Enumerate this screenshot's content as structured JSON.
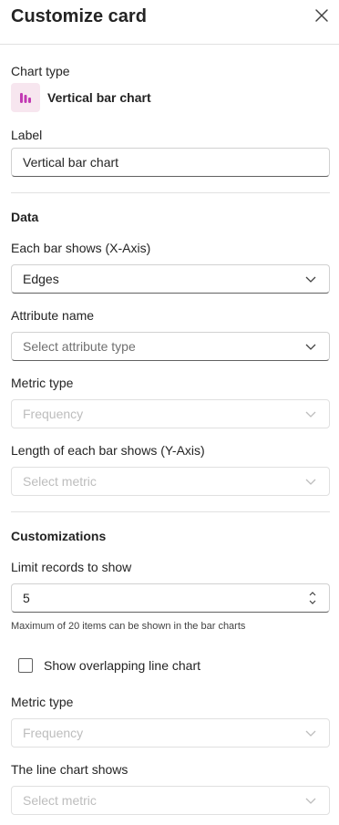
{
  "panel": {
    "title": "Customize card"
  },
  "chart_type": {
    "label": "Chart type",
    "value": "Vertical bar chart",
    "icon": "vertical-bar-chart-icon",
    "accent": "#c239b3"
  },
  "label_field": {
    "label": "Label",
    "value": "Vertical bar chart"
  },
  "data_section": {
    "title": "Data",
    "x_axis": {
      "label": "Each bar shows (X-Axis)",
      "value": "Edges"
    },
    "attribute": {
      "label": "Attribute name",
      "placeholder": "Select attribute type"
    },
    "metric_type": {
      "label": "Metric type",
      "value": "Frequency"
    },
    "y_axis": {
      "label": "Length of each bar shows (Y-Axis)",
      "placeholder": "Select metric"
    }
  },
  "customizations": {
    "title": "Customizations",
    "limit": {
      "label": "Limit records to show",
      "value": "5",
      "help": "Maximum of 20 items can be shown in the bar charts"
    },
    "overlap": {
      "label": "Show overlapping line chart",
      "checked": false
    },
    "line_metric_type": {
      "label": "Metric type",
      "value": "Frequency"
    },
    "line_chart": {
      "label": "The line chart shows",
      "placeholder": "Select metric"
    }
  }
}
